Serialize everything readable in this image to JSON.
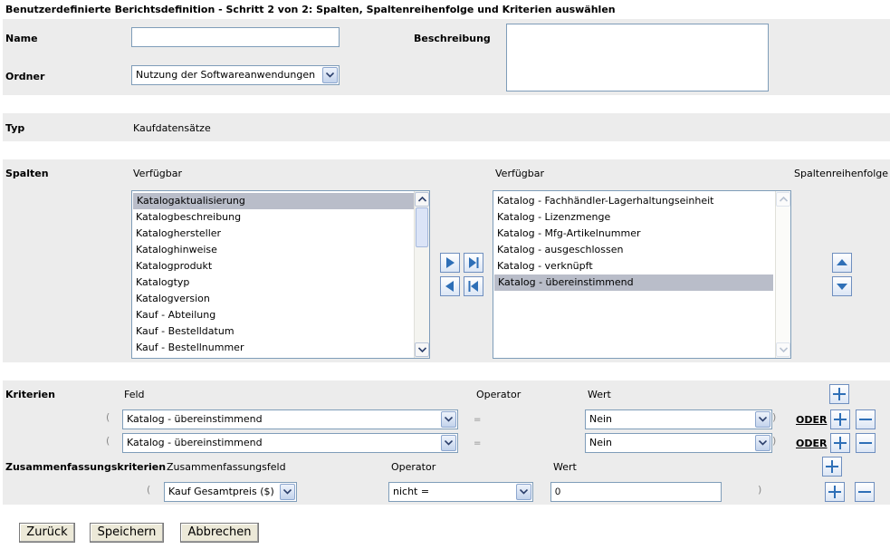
{
  "page_title": "Benutzerdefinierte Berichtsdefinition - Schritt 2 von 2: Spalten, Spaltenreihenfolge und Kriterien auswählen",
  "form": {
    "name_label": "Name",
    "name_value": "",
    "description_label": "Beschreibung",
    "description_value": "",
    "folder_label": "Ordner",
    "folder_value": "Nutzung der Softwareanwendungen",
    "type_label": "Typ",
    "type_value": "Kaufdatensätze"
  },
  "columns": {
    "label": "Spalten",
    "available_header": "Verfügbar",
    "selected_header": "Verfügbar",
    "order_header": "Spaltenreihenfolge",
    "available_items": [
      "Katalogaktualisierung",
      "Katalogbeschreibung",
      "Kataloghersteller",
      "Kataloghinweise",
      "Katalogprodukt",
      "Katalogtyp",
      "Katalogversion",
      "Kauf - Abteilung",
      "Kauf - Bestelldatum",
      "Kauf - Bestellnummer"
    ],
    "available_selected_index": 0,
    "selected_items": [
      "Katalog - Fachhändler-Lagerhaltungseinheit",
      "Katalog - Lizenzmenge",
      "Katalog - Mfg-Artikelnummer",
      "Katalog - ausgeschlossen",
      "Katalog - verknüpft",
      "Katalog - übereinstimmend"
    ],
    "selected_selected_index": 5
  },
  "criteria": {
    "label": "Kriterien",
    "field_header": "Feld",
    "operator_header": "Operator",
    "value_header": "Wert",
    "rows": [
      {
        "open_paren": "(",
        "field": "Katalog - übereinstimmend",
        "operator": "=",
        "value": "Nein",
        "close_paren": ")",
        "connector": "ODER"
      },
      {
        "open_paren": "(",
        "field": "Katalog - übereinstimmend",
        "operator": "=",
        "value": "Nein",
        "close_paren": ")",
        "connector": "ODER"
      }
    ]
  },
  "summary": {
    "label": "Zusammenfassungskriterien",
    "field_header": "Zusammenfassungsfeld",
    "operator_header": "Operator",
    "value_header": "Wert",
    "row": {
      "open_paren": "(",
      "field": "Kauf  Gesamtpreis ($)",
      "operator": "nicht =",
      "value": "0",
      "close_paren": ")"
    }
  },
  "buttons": {
    "back": "Zurück",
    "save": "Speichern",
    "cancel": "Abbrechen"
  },
  "colors": {
    "band": "#ececec",
    "button_accent": "#2e6fb7",
    "selection": "#b9bdc9"
  }
}
